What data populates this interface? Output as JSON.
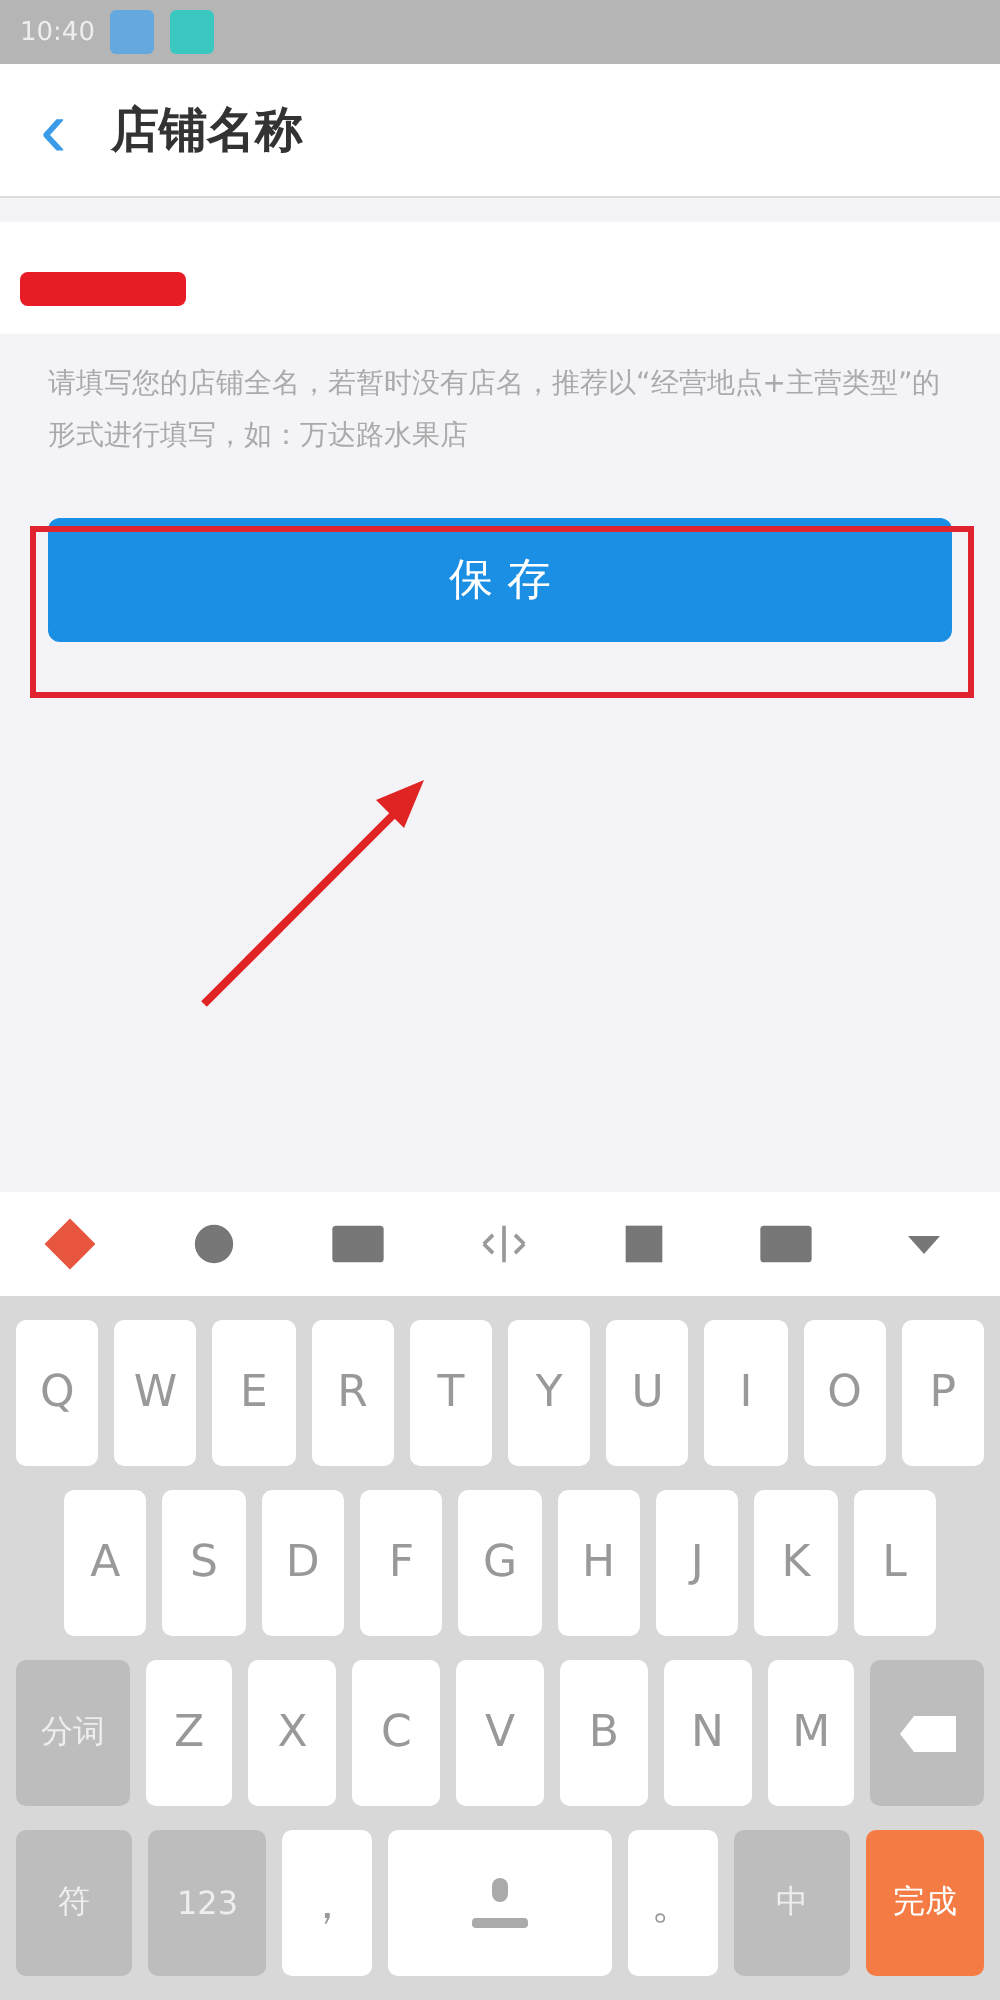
{
  "status_bar": {
    "time": "10:40"
  },
  "header": {
    "back": "‹",
    "title": "店铺名称"
  },
  "hint": "请填写您的店铺全名，若暂时没有店名，推荐以“经营地点+主营类型”的形式进行填写，如：万达路水果店",
  "save_button": "保 存",
  "keyboard": {
    "rows": [
      {
        "keys": [
          {
            "label": "Q",
            "kind": "letter"
          },
          {
            "label": "W",
            "kind": "letter"
          },
          {
            "label": "E",
            "kind": "letter"
          },
          {
            "label": "R",
            "kind": "letter"
          },
          {
            "label": "T",
            "kind": "letter"
          },
          {
            "label": "Y",
            "kind": "letter"
          },
          {
            "label": "U",
            "kind": "letter"
          },
          {
            "label": "I",
            "kind": "letter"
          },
          {
            "label": "O",
            "kind": "letter"
          },
          {
            "label": "P",
            "kind": "letter"
          }
        ]
      },
      {
        "keys": [
          {
            "label": "A",
            "kind": "letter"
          },
          {
            "label": "S",
            "kind": "letter"
          },
          {
            "label": "D",
            "kind": "letter"
          },
          {
            "label": "F",
            "kind": "letter"
          },
          {
            "label": "G",
            "kind": "letter"
          },
          {
            "label": "H",
            "kind": "letter"
          },
          {
            "label": "J",
            "kind": "letter"
          },
          {
            "label": "K",
            "kind": "letter"
          },
          {
            "label": "L",
            "kind": "letter"
          }
        ]
      },
      {
        "keys": [
          {
            "label": "分词",
            "kind": "function"
          },
          {
            "label": "Z",
            "kind": "letter"
          },
          {
            "label": "X",
            "kind": "letter"
          },
          {
            "label": "C",
            "kind": "letter"
          },
          {
            "label": "V",
            "kind": "letter"
          },
          {
            "label": "B",
            "kind": "letter"
          },
          {
            "label": "N",
            "kind": "letter"
          },
          {
            "label": "M",
            "kind": "letter"
          },
          {
            "kind": "backspace"
          }
        ]
      },
      {
        "keys": [
          {
            "label": "符",
            "kind": "function"
          },
          {
            "label": "123",
            "kind": "function"
          },
          {
            "label": "，",
            "kind": "letter"
          },
          {
            "kind": "space"
          },
          {
            "label": "。",
            "kind": "letter"
          },
          {
            "label": "中",
            "kind": "function"
          },
          {
            "label": "完成",
            "kind": "action"
          }
        ]
      }
    ]
  }
}
